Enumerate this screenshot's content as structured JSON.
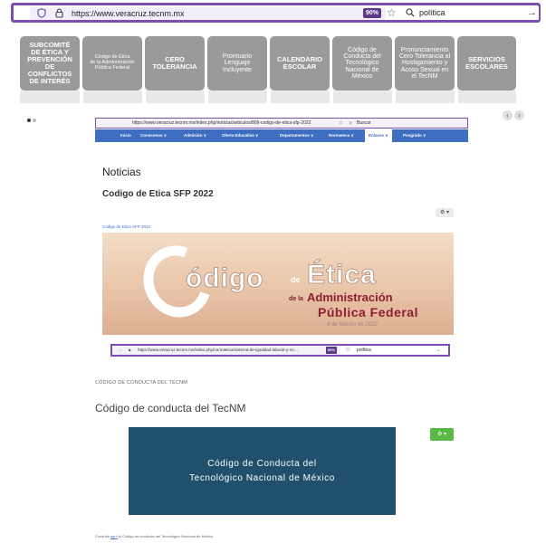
{
  "browser": {
    "url": "https://www.veracruz.tecnm.mx",
    "zoom": "90%",
    "search": "política"
  },
  "tiles": [
    {
      "lines": [
        "SUBCOMITÉ",
        "DE ÉTICA Y",
        "PREVENCIÓN",
        "DE CONFLICTOS",
        "DE INTERÉS"
      ]
    },
    {
      "lines": [
        "Código de Ética",
        "de la Administración",
        "Pública Federal"
      ]
    },
    {
      "lines": [
        "CERO",
        "TOLERANCIA"
      ]
    },
    {
      "lines": [
        "Prontuario",
        "Lenguaje",
        "Incluyente"
      ]
    },
    {
      "lines": [
        "CALENDARIO",
        "ESCOLAR"
      ]
    },
    {
      "lines": [
        "Código de",
        "Conducta del",
        "Tecnológico",
        "Nacional de",
        "México"
      ]
    },
    {
      "lines": [
        "Pronunciamiento",
        "Cero Tolerancia al",
        "Hostigamiento y",
        "Acoso Sexual en",
        "el TecNM"
      ]
    },
    {
      "lines": [
        "SERVICIOS",
        "ESCOLARES"
      ]
    }
  ],
  "page1": {
    "url": "https://www.veracruz.tecnm.mx/index.php/noticias/articulos/809-codigo-de-etica-sfp-2022",
    "search_placeholder": "Buscar",
    "nav": [
      "Inicio",
      "Conócenos",
      "Admisión",
      "Oferta Educativa",
      "Departamentos",
      "Normateca",
      "Enlaces",
      "Posgrado"
    ],
    "section": "Noticias",
    "title": "Codigo de Etica SFP 2022",
    "link": "Codigo de Etica SFP 2022",
    "hero": {
      "c": "C",
      "odigo": "ódigo",
      "de": "de",
      "etica": "Ética",
      "dela": "de la",
      "admin": "Administración",
      "pub": "Pública Federal",
      "date": "8 de febrero de 2022"
    }
  },
  "page2": {
    "url": "https://www.veracruz.tecnm.mx/index.php/normateca/sistema-de-igualdad-laboral-y-no-...",
    "zoom": "90%",
    "search": "política",
    "breadcrumb": "CÓDIGO DE CONDUCTA DEL TECNM",
    "title": "Código de conducta del TecNM",
    "banner_line1": "Código de Conducta del",
    "banner_line2": "Tecnológico Nacional de México",
    "footer_pre": "Consulte",
    "footer_link": "aquí",
    "footer_post": "el Código de conducta del Tecnológico Nacional de México"
  },
  "colors": {
    "accent": "#7b4fb0",
    "nav_blue": "#3d6ec1",
    "tile_gray": "#9a9a9a",
    "banner": "#21506e",
    "green": "#58b946"
  },
  "icons": [
    "shield-icon",
    "lock-icon",
    "star-icon",
    "search-icon",
    "arrow-right-icon",
    "gear-icon",
    "chevron-left-icon",
    "chevron-right-icon"
  ]
}
